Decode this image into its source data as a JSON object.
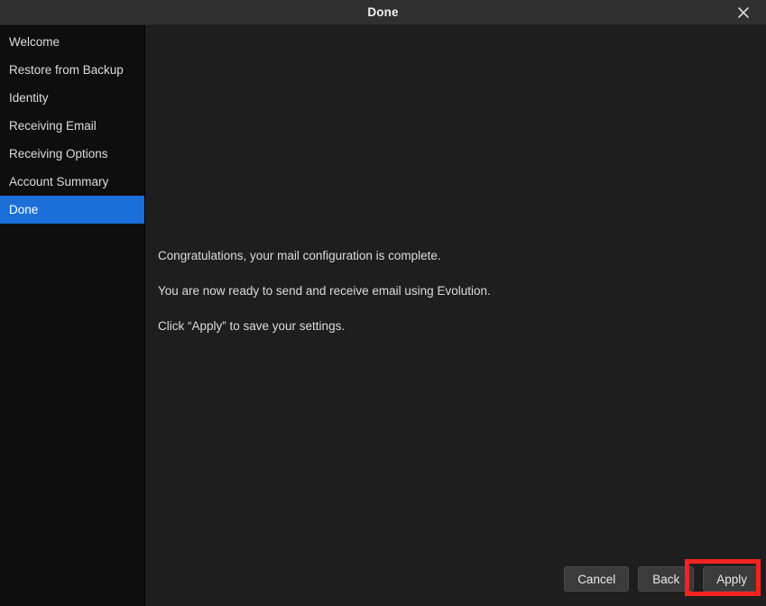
{
  "window": {
    "title": "Done",
    "close_icon": "close-icon"
  },
  "sidebar": {
    "items": [
      {
        "label": "Welcome",
        "selected": false
      },
      {
        "label": "Restore from Backup",
        "selected": false
      },
      {
        "label": "Identity",
        "selected": false
      },
      {
        "label": "Receiving Email",
        "selected": false
      },
      {
        "label": "Receiving Options",
        "selected": false
      },
      {
        "label": "Account Summary",
        "selected": false
      },
      {
        "label": "Done",
        "selected": true
      }
    ],
    "selected_label": "Done",
    "selection_color": "#1c6fd8"
  },
  "main": {
    "lines": [
      "Congratulations, your mail configuration is complete.",
      "You are now ready to send and receive email using Evolution.",
      "Click “Apply” to save your settings."
    ]
  },
  "footer": {
    "cancel_label": "Cancel",
    "back_label": "Back",
    "apply_label": "Apply"
  },
  "annotation": {
    "target": "apply-button",
    "color": "#f4231f"
  }
}
